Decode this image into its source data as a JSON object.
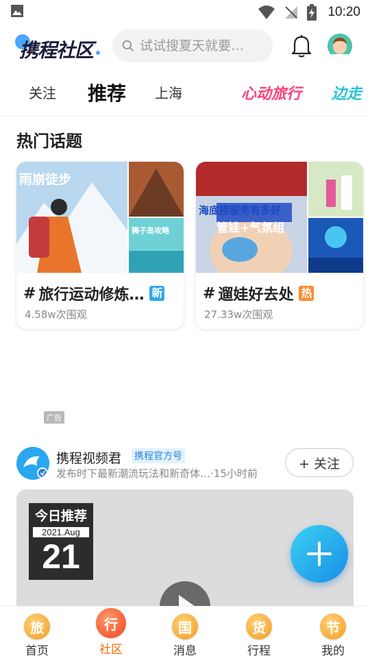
{
  "status_bar": {
    "time": "10:20"
  },
  "header": {
    "logo_text": "携程社区",
    "search_placeholder": "试试搜夏天就要…"
  },
  "tabs": [
    {
      "label": "关注"
    },
    {
      "label": "推荐"
    },
    {
      "label": "上海"
    },
    {
      "label": "心动旅行"
    },
    {
      "label": "边走"
    }
  ],
  "hot_topics": {
    "title": "热门话题",
    "items": [
      {
        "hash": "#",
        "name": "旅行运动修炼…",
        "badge": "新",
        "views": "4.58w次围观",
        "img_texts": [
          "雨崩徒步",
          "狮子岛攻略"
        ]
      },
      {
        "hash": "#",
        "name": "遛娃好去处",
        "badge": "热",
        "views": "27.33w次围观",
        "img_texts": [
          "海底捞服务有多好",
          "管娃+气氛组"
        ]
      }
    ]
  },
  "ad": {
    "label": "广告"
  },
  "post": {
    "author_name": "携程视频君",
    "official_badge": "携程官方号",
    "desc": "发布时下最新潮流玩法和新奇体…·15小时前",
    "follow_label": "+ 关注",
    "calendar": {
      "head": "今日推荐",
      "month": "2021.Aug",
      "day": "21"
    }
  },
  "bottom_nav": [
    {
      "icon": "旅",
      "label": "首页"
    },
    {
      "icon": "行",
      "label": "社区"
    },
    {
      "icon": "国",
      "label": "消息"
    },
    {
      "icon": "货",
      "label": "行程"
    },
    {
      "icon": "节",
      "label": "我的"
    }
  ],
  "colors": {
    "accent": "#1e9cf0",
    "orange": "#ff6a00",
    "pink": "#ff3f7b"
  }
}
